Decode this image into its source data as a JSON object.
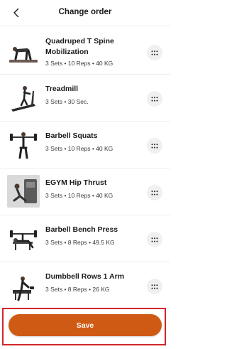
{
  "header": {
    "title": "Change order",
    "back_icon": "chevron-left-icon"
  },
  "exercises": [
    {
      "name": "Quadruped T Spine Mobilization",
      "meta": "3 Sets • 10 Reps • 40 KG"
    },
    {
      "name": "Treadmill",
      "meta": "3 Sets • 30 Sec."
    },
    {
      "name": "Barbell Squats",
      "meta": "3 Sets • 10 Reps • 40 KG"
    },
    {
      "name": "EGYM Hip Thrust",
      "meta": "3 Sets • 10 Reps • 40 KG"
    },
    {
      "name": "Barbell Bench Press",
      "meta": "3 Sets • 8 Reps • 49.5 KG"
    },
    {
      "name": "Dumbbell Rows 1 Arm",
      "meta": "3 Sets • 8 Reps • 26 KG"
    }
  ],
  "footer": {
    "save_label": "Save"
  },
  "colors": {
    "accent": "#cf5a14",
    "highlight_frame": "#d0262b",
    "handle_bg": "#f0f0f0"
  }
}
